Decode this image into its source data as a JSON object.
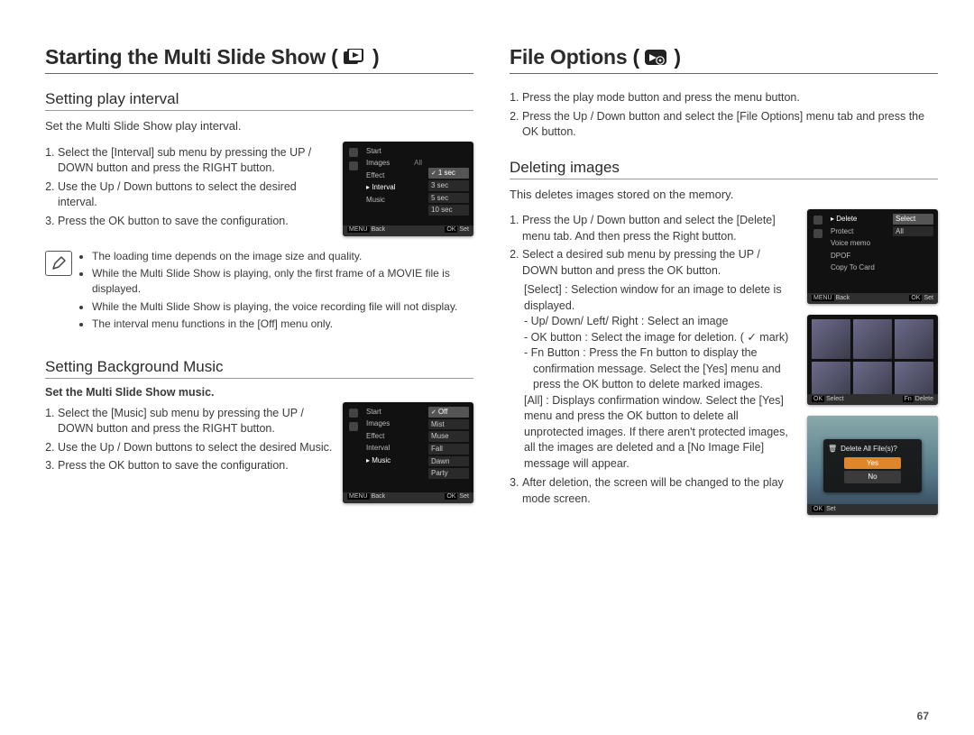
{
  "page_number": "67",
  "left": {
    "title": "Starting the Multi Slide Show",
    "title_icon_name": "slideshow-play-icon",
    "section1": {
      "heading": "Setting play interval",
      "intro": "Set the Multi Slide Show play interval.",
      "steps": [
        "Select the [Interval] sub menu by pressing the UP / DOWN button and press the RIGHT button.",
        "Use the Up / Down buttons to select the desired interval.",
        "Press the OK button to save the configuration."
      ],
      "menu": {
        "items": [
          "Start",
          "Images",
          "Effect",
          "Interval",
          "Music"
        ],
        "value_label": "All",
        "values": [
          "1 sec",
          "3 sec",
          "5 sec",
          "10 sec"
        ],
        "selected_value": "1 sec",
        "footer_left_key": "MENU",
        "footer_left_text": "Back",
        "footer_right_key": "OK",
        "footer_right_text": "Set"
      },
      "notes": [
        "The loading time depends on the image size and quality.",
        "While the Multi Slide Show is playing, only the first frame of a MOVIE file is displayed.",
        "While the Multi Slide Show is playing, the voice recording file will not display.",
        "The interval menu functions in the [Off] menu only."
      ]
    },
    "section2": {
      "heading": "Setting Background Music",
      "bold_intro": "Set the Multi Slide Show music.",
      "steps": [
        "Select the [Music] sub menu by pressing the UP / DOWN button and press the RIGHT button.",
        "Use the Up / Down buttons to select the desired Music.",
        "Press the OK button to save the configuration."
      ],
      "menu": {
        "items": [
          "Start",
          "Images",
          "Effect",
          "Interval",
          "Music"
        ],
        "values": [
          "Off",
          "Mist",
          "Muse",
          "Fall",
          "Dawn",
          "Party"
        ],
        "selected_value": "Off",
        "footer_left_key": "MENU",
        "footer_left_text": "Back",
        "footer_right_key": "OK",
        "footer_right_text": "Set"
      }
    }
  },
  "right": {
    "title": "File Options",
    "title_icon_name": "file-options-gear-icon",
    "intro_steps": [
      "Press the play mode button and press the menu button.",
      "Press the Up / Down button and select the [File Options] menu tab and press the OK button."
    ],
    "section1": {
      "heading": "Deleting images",
      "intro": "This deletes images stored on the memory.",
      "step1": "Press the Up / Down button and select the [Delete] menu tab. And then press the Right button.",
      "step2": "Select a desired sub menu by pressing the UP / DOWN button and press the OK button.",
      "select_label": "[Select] : Selection window for an image to delete is displayed.",
      "select_sub": [
        "- Up/ Down/ Left/ Right : Select an image",
        "- OK button : Select the image for deletion. ( ✓ mark)",
        "- Fn Button : Press the Fn button to display the confirmation message. Select the [Yes] menu and press the OK button to delete marked images."
      ],
      "all_label": "[All] : Displays confirmation window. Select the [Yes] menu and press the OK button to delete all unprotected images. If there aren't protected images, all the images are deleted and a [No Image File] message will appear.",
      "step3": "After deletion, the screen will be changed to the play mode screen.",
      "menu": {
        "items": [
          "Delete",
          "Protect",
          "Voice memo",
          "DPOF",
          "Copy To Card"
        ],
        "values": [
          "Select",
          "All"
        ],
        "selected_value": "Select",
        "footer_left_key": "MENU",
        "footer_left_text": "Back",
        "footer_right_key": "OK",
        "footer_right_text": "Set"
      },
      "thumbs_footer_left_key": "OK",
      "thumbs_footer_left_text": "Select",
      "thumbs_footer_right_key": "Fn",
      "thumbs_footer_right_text": "Delete",
      "dialog": {
        "title": "Delete All File(s)?",
        "yes": "Yes",
        "no": "No",
        "footer_key": "OK",
        "footer_text": "Set"
      }
    }
  }
}
